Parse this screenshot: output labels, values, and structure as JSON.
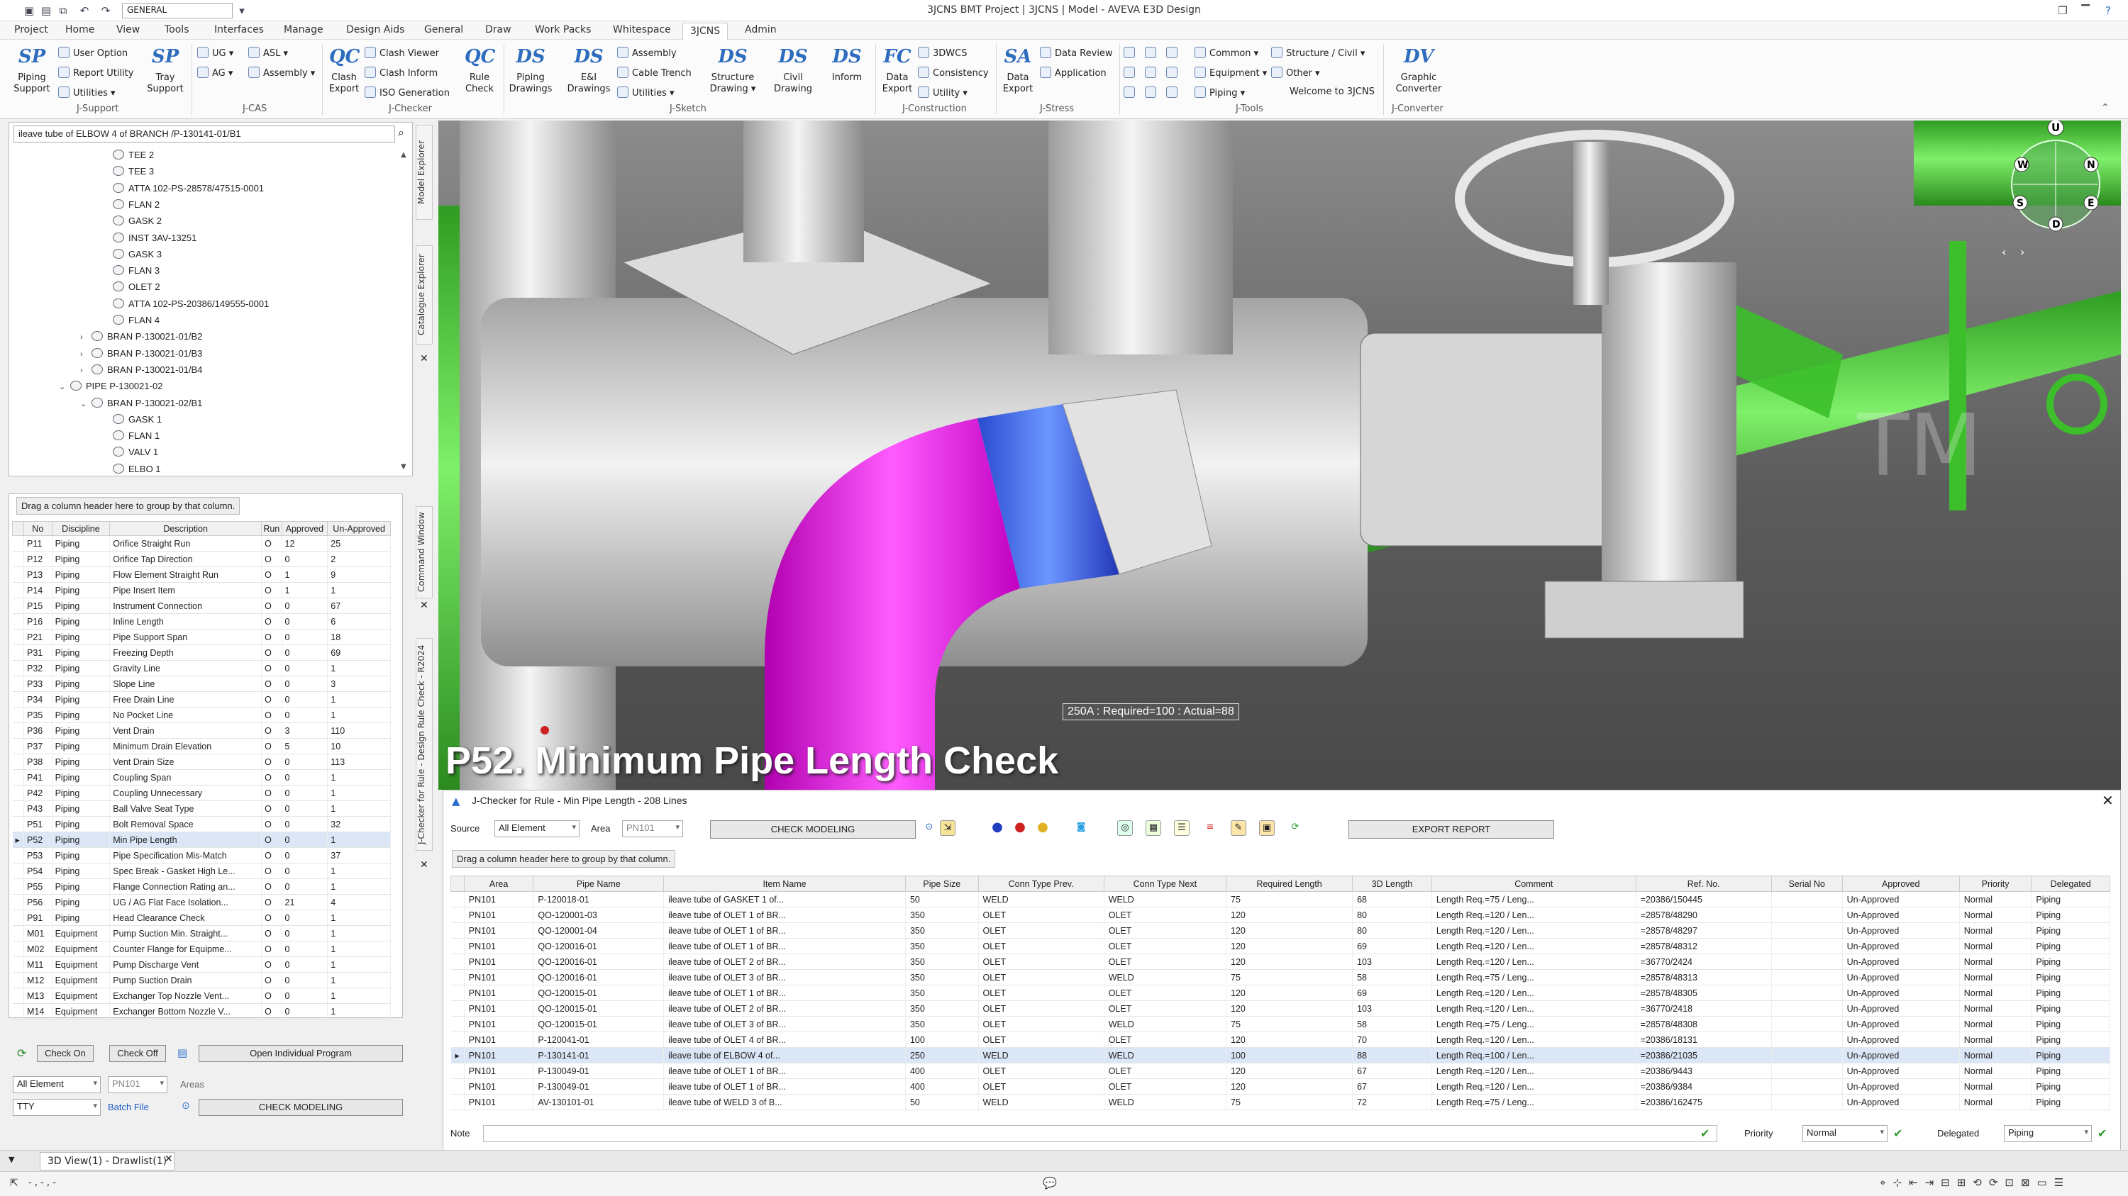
{
  "titlebar": {
    "title": "3JCNS BMT Project | 3JCNS | Model - AVEVA E3D Design",
    "theme": "GENERAL",
    "qa_icons": [
      "save-icon",
      "layout-icon",
      "copy-icon",
      "undo-icon",
      "redo-icon"
    ],
    "win_icons": [
      "restore-icon",
      "minimize-icon",
      "help-icon"
    ]
  },
  "menu": {
    "items": [
      "Project",
      "Home",
      "View",
      "Tools",
      "Interfaces",
      "Manage",
      "Design Aids",
      "General",
      "Draw",
      "Work Packs",
      "Whitespace",
      "3JCNS",
      "Admin"
    ],
    "active": "3JCNS"
  },
  "ribbon": {
    "groups": {
      "jsupport": "J-Support",
      "jcas": "J-CAS",
      "jchecker": "J-Checker",
      "jsketch": "J-Sketch",
      "jconstruction": "J-Construction",
      "jstress": "J-Stress",
      "jtools": "J-Tools",
      "jconverter": "J-Converter"
    },
    "piping_support": "Piping\nSupport",
    "user_option": "User Option",
    "report_utility": "Report Utility",
    "utilities": "Utilities ▾",
    "tray_support": "Tray\nSupport",
    "ug": "UG ▾",
    "asl": "ASL ▾",
    "ag": "AG ▾",
    "assembly": "Assembly ▾",
    "clash_export": "Clash\nExport",
    "clash_viewer": "Clash Viewer",
    "clash_inform": "Clash Inform",
    "iso_generation": "ISO Generation",
    "rule_check": "Rule\nCheck",
    "piping_drawings": "Piping\nDrawings",
    "ei_drawings": "E&I\nDrawings",
    "sk_assembly": "Assembly",
    "cable_trench": "Cable Trench",
    "sk_utilities": "Utilities ▾",
    "structure_drawing": "Structure\nDrawing ▾",
    "civil_drawing": "Civil\nDrawing",
    "inform": "Inform",
    "data_export": "Data\nExport",
    "dwcs": "3DWCS",
    "consistency": "Consistency",
    "utility": "Utility ▾",
    "stress_data_export": "Data\nExport",
    "data_review": "Data Review",
    "application": "Application",
    "common": "Common ▾",
    "structure_civil": "Structure / Civil ▾",
    "equipment": "Equipment ▾",
    "other": "Other ▾",
    "piping": "Piping ▾",
    "welcome": "Welcome to 3JCNS",
    "graphic_converter": "Graphic\nConverter"
  },
  "tree": {
    "search_value": "ileave tube of ELBOW 4 of BRANCH /P-130141-01/B1",
    "rows": [
      {
        "label": "TEE 2",
        "indent": 2
      },
      {
        "label": "TEE 3",
        "indent": 2
      },
      {
        "label": "ATTA 102-PS-28578/47515-0001",
        "indent": 2
      },
      {
        "label": "FLAN 2",
        "indent": 2
      },
      {
        "label": "GASK 2",
        "indent": 2
      },
      {
        "label": "INST 3AV-13251",
        "indent": 2
      },
      {
        "label": "GASK 3",
        "indent": 2
      },
      {
        "label": "FLAN 3",
        "indent": 2
      },
      {
        "label": "OLET 2",
        "indent": 2
      },
      {
        "label": "ATTA 102-PS-20386/149555-0001",
        "indent": 2
      },
      {
        "label": "FLAN 4",
        "indent": 2
      },
      {
        "label": "BRAN P-130021-01/B2",
        "indent": 1,
        "toggle": "›"
      },
      {
        "label": "BRAN P-130021-01/B3",
        "indent": 1,
        "toggle": "›"
      },
      {
        "label": "BRAN P-130021-01/B4",
        "indent": 1,
        "toggle": "›"
      },
      {
        "label": "PIPE P-130021-02",
        "indent": 0,
        "toggle": "⌄"
      },
      {
        "label": "BRAN P-130021-02/B1",
        "indent": 1,
        "toggle": "⌄"
      },
      {
        "label": "GASK 1",
        "indent": 2
      },
      {
        "label": "FLAN 1",
        "indent": 2
      },
      {
        "label": "VALV 1",
        "indent": 2
      },
      {
        "label": "ELBO 1",
        "indent": 2
      }
    ]
  },
  "side_tabs": {
    "model_explorer": "Model Explorer",
    "catalogue_explorer": "Catalogue Explorer",
    "command_window": "Command Window",
    "rule_check_tab": "J-Checker for Rule - Design Rule Check - R2024"
  },
  "rules": {
    "group_hint": "Drag a column header here to group by that column.",
    "columns": [
      "No",
      "Discipline",
      "Description",
      "Run",
      "Approved",
      "Un-Approved"
    ],
    "rows": [
      [
        "P11",
        "Piping",
        "Orifice Straight Run",
        "O",
        "12",
        "25"
      ],
      [
        "P12",
        "Piping",
        "Orifice Tap Direction",
        "O",
        "0",
        "2"
      ],
      [
        "P13",
        "Piping",
        "Flow Element Straight Run",
        "O",
        "1",
        "9"
      ],
      [
        "P14",
        "Piping",
        "Pipe Insert Item",
        "O",
        "1",
        "1"
      ],
      [
        "P15",
        "Piping",
        "Instrument Connection",
        "O",
        "0",
        "67"
      ],
      [
        "P16",
        "Piping",
        "Inline Length",
        "O",
        "0",
        "6"
      ],
      [
        "P21",
        "Piping",
        "Pipe Support Span",
        "O",
        "0",
        "18"
      ],
      [
        "P31",
        "Piping",
        "Freezing Depth",
        "O",
        "0",
        "69"
      ],
      [
        "P32",
        "Piping",
        "Gravity Line",
        "O",
        "0",
        "1"
      ],
      [
        "P33",
        "Piping",
        "Slope Line",
        "O",
        "0",
        "3"
      ],
      [
        "P34",
        "Piping",
        "Free Drain Line",
        "O",
        "0",
        "1"
      ],
      [
        "P35",
        "Piping",
        "No Pocket Line",
        "O",
        "0",
        "1"
      ],
      [
        "P36",
        "Piping",
        "Vent Drain",
        "O",
        "3",
        "110"
      ],
      [
        "P37",
        "Piping",
        "Minimum Drain Elevation",
        "O",
        "5",
        "10"
      ],
      [
        "P38",
        "Piping",
        "Vent Drain Size",
        "O",
        "0",
        "113"
      ],
      [
        "P41",
        "Piping",
        "Coupling Span",
        "O",
        "0",
        "1"
      ],
      [
        "P42",
        "Piping",
        "Coupling Unnecessary",
        "O",
        "0",
        "1"
      ],
      [
        "P43",
        "Piping",
        "Ball Valve Seat Type",
        "O",
        "0",
        "1"
      ],
      [
        "P51",
        "Piping",
        "Bolt Removal Space",
        "O",
        "0",
        "32"
      ],
      [
        "P52",
        "Piping",
        "Min Pipe Length",
        "O",
        "0",
        "1"
      ],
      [
        "P53",
        "Piping",
        "Pipe Specification Mis-Match",
        "O",
        "0",
        "37"
      ],
      [
        "P54",
        "Piping",
        "Spec Break - Gasket High Le...",
        "O",
        "0",
        "1"
      ],
      [
        "P55",
        "Piping",
        "Flange Connection Rating an...",
        "O",
        "0",
        "1"
      ],
      [
        "P56",
        "Piping",
        "UG / AG Flat Face Isolation...",
        "O",
        "21",
        "4"
      ],
      [
        "P91",
        "Piping",
        "Head Clearance Check",
        "O",
        "0",
        "1"
      ],
      [
        "M01",
        "Equipment",
        "Pump Suction Min. Straight...",
        "O",
        "0",
        "1"
      ],
      [
        "M02",
        "Equipment",
        "Counter Flange for Equipme...",
        "O",
        "0",
        "1"
      ],
      [
        "M11",
        "Equipment",
        "Pump Discharge Vent",
        "O",
        "0",
        "1"
      ],
      [
        "M12",
        "Equipment",
        "Pump Suction Drain",
        "O",
        "0",
        "1"
      ],
      [
        "M13",
        "Equipment",
        "Exchanger Top Nozzle Vent...",
        "O",
        "0",
        "1"
      ],
      [
        "M14",
        "Equipment",
        "Exchanger Bottom Nozzle V...",
        "O",
        "0",
        "1"
      ]
    ],
    "selected_index": 19,
    "check_on": "Check On",
    "check_off": "Check Off",
    "open_program": "Open Individual Program",
    "element_value": "All Element",
    "area_value": "PN101",
    "areas_label": "Areas",
    "tty_value": "TTY",
    "batch_file": "Batch File",
    "check_modeling": "CHECK MODELING"
  },
  "view": {
    "overlay_title": "P52. Minimum Pipe Length Check",
    "measure_label": "250A : Required=100 : Actual=88",
    "watermark": "TM",
    "compass": {
      "u": "U",
      "w": "W",
      "n": "N",
      "s": "S",
      "e": "E",
      "d": "D"
    }
  },
  "checker": {
    "title": "J-Checker for Rule - Min Pipe Length - 208 Lines",
    "source_label": "Source",
    "source_value": "All Element",
    "area_label": "Area",
    "area_value": "PN101",
    "check_modeling": "CHECK MODELING",
    "export_report": "EXPORT REPORT",
    "group_hint": "Drag a column header here to group by that column.",
    "columns": [
      "Area",
      "Pipe Name",
      "Item Name",
      "Pipe Size",
      "Conn Type Prev.",
      "Conn Type Next",
      "Required Length",
      "3D Length",
      "Comment",
      "Ref. No.",
      "Serial No",
      "Approved",
      "Priority",
      "Delegated"
    ],
    "rows": [
      [
        "PN101",
        "P-120018-01",
        "ileave tube of GASKET 1 of...",
        "50",
        "WELD",
        "WELD",
        "75",
        "68",
        "Length Req.=75 / Leng...",
        "=20386/150445",
        "",
        "Un-Approved",
        "Normal",
        "Piping"
      ],
      [
        "PN101",
        "QO-120001-03",
        "ileave tube of OLET 1 of BR...",
        "350",
        "OLET",
        "OLET",
        "120",
        "80",
        "Length Req.=120 / Len...",
        "=28578/48290",
        "",
        "Un-Approved",
        "Normal",
        "Piping"
      ],
      [
        "PN101",
        "QO-120001-04",
        "ileave tube of OLET 1 of BR...",
        "350",
        "OLET",
        "OLET",
        "120",
        "80",
        "Length Req.=120 / Len...",
        "=28578/48297",
        "",
        "Un-Approved",
        "Normal",
        "Piping"
      ],
      [
        "PN101",
        "QO-120016-01",
        "ileave tube of OLET 1 of BR...",
        "350",
        "OLET",
        "OLET",
        "120",
        "69",
        "Length Req.=120 / Len...",
        "=28578/48312",
        "",
        "Un-Approved",
        "Normal",
        "Piping"
      ],
      [
        "PN101",
        "QO-120016-01",
        "ileave tube of OLET 2 of BR...",
        "350",
        "OLET",
        "OLET",
        "120",
        "103",
        "Length Req.=120 / Len...",
        "=36770/2424",
        "",
        "Un-Approved",
        "Normal",
        "Piping"
      ],
      [
        "PN101",
        "QO-120016-01",
        "ileave tube of OLET 3 of BR...",
        "350",
        "OLET",
        "WELD",
        "75",
        "58",
        "Length Req.=75 / Leng...",
        "=28578/48313",
        "",
        "Un-Approved",
        "Normal",
        "Piping"
      ],
      [
        "PN101",
        "QO-120015-01",
        "ileave tube of OLET 1 of BR...",
        "350",
        "OLET",
        "OLET",
        "120",
        "69",
        "Length Req.=120 / Len...",
        "=28578/48305",
        "",
        "Un-Approved",
        "Normal",
        "Piping"
      ],
      [
        "PN101",
        "QO-120015-01",
        "ileave tube of OLET 2 of BR...",
        "350",
        "OLET",
        "OLET",
        "120",
        "103",
        "Length Req.=120 / Len...",
        "=36770/2418",
        "",
        "Un-Approved",
        "Normal",
        "Piping"
      ],
      [
        "PN101",
        "QO-120015-01",
        "ileave tube of OLET 3 of BR...",
        "350",
        "OLET",
        "WELD",
        "75",
        "58",
        "Length Req.=75 / Leng...",
        "=28578/48308",
        "",
        "Un-Approved",
        "Normal",
        "Piping"
      ],
      [
        "PN101",
        "P-120041-01",
        "ileave tube of OLET 4 of BR...",
        "100",
        "OLET",
        "OLET",
        "120",
        "70",
        "Length Req.=120 / Len...",
        "=20386/18131",
        "",
        "Un-Approved",
        "Normal",
        "Piping"
      ],
      [
        "PN101",
        "P-130141-01",
        "ileave tube of ELBOW 4 of...",
        "250",
        "WELD",
        "WELD",
        "100",
        "88",
        "Length Req.=100 / Len...",
        "=20386/21035",
        "",
        "Un-Approved",
        "Normal",
        "Piping"
      ],
      [
        "PN101",
        "P-130049-01",
        "ileave tube of OLET 1 of BR...",
        "400",
        "OLET",
        "OLET",
        "120",
        "67",
        "Length Req.=120 / Len...",
        "=20386/9443",
        "",
        "Un-Approved",
        "Normal",
        "Piping"
      ],
      [
        "PN101",
        "P-130049-01",
        "ileave tube of OLET 1 of BR...",
        "400",
        "OLET",
        "OLET",
        "120",
        "67",
        "Length Req.=120 / Len...",
        "=20386/9384",
        "",
        "Un-Approved",
        "Normal",
        "Piping"
      ],
      [
        "PN101",
        "AV-130101-01",
        "ileave tube of WELD 3 of B...",
        "50",
        "WELD",
        "WELD",
        "75",
        "72",
        "Length Req.=75 / Leng...",
        "=20386/162475",
        "",
        "Un-Approved",
        "Normal",
        "Piping"
      ]
    ],
    "selected_index": 10,
    "note_label": "Note",
    "priority_label": "Priority",
    "priority_value": "Normal",
    "delegated_label": "Delegated",
    "delegated_value": "Piping"
  },
  "doc_tabs": {
    "tab1": "3D View(1) - Drawlist(1)"
  },
  "status": {
    "text": "- , - , -"
  }
}
